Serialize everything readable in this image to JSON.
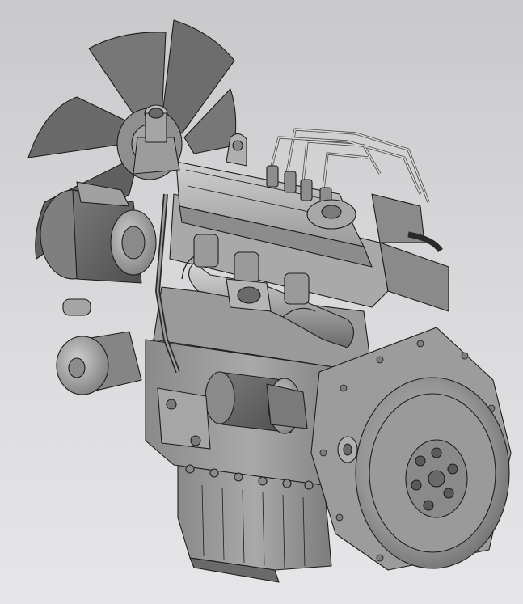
{
  "viewport": {
    "background_top": "#c9c9cb",
    "background_bottom": "#e6e6e8",
    "model": "diesel-engine-assembly-3d-render"
  },
  "palette": {
    "metal_light": "#c4c4c4",
    "metal_mid": "#9e9e9e",
    "metal_dark": "#6e6e6e",
    "metal_shadow": "#4a4a4a",
    "edge": "#1e1e1e",
    "hose_black": "#2a2a2a"
  }
}
